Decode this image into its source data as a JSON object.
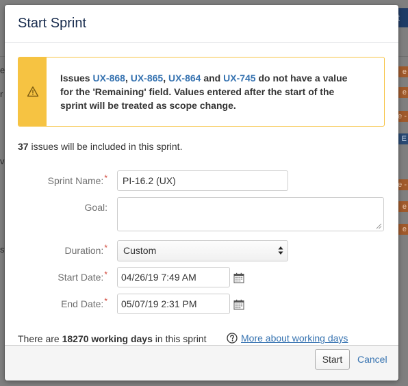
{
  "background": {
    "top_button": "rt",
    "side_texts": [
      "e",
      "r",
      "vo",
      "st"
    ],
    "badges": [
      "e F",
      "e F",
      "e -",
      "E",
      "e -",
      "e F",
      "e F"
    ]
  },
  "dialog": {
    "title": "Start Sprint",
    "warning": {
      "prefix": "Issues ",
      "issues": [
        "UX-868",
        "UX-865",
        "UX-864",
        "UX-745"
      ],
      "sep1": ", ",
      "sep2": ", ",
      "and": " and ",
      "suffix": " do not have a value for the 'Remaining' field. Values entered after the start of the sprint will be treated as scope change."
    },
    "issue_count": {
      "number": "37",
      "text": " issues will be included in this sprint."
    },
    "form": {
      "sprint_name_label": "Sprint Name:",
      "sprint_name_value": "PI-16.2 (UX)",
      "goal_label": "Goal:",
      "goal_value": "",
      "duration_label": "Duration:",
      "duration_value": "Custom",
      "start_date_label": "Start Date:",
      "start_date_value": "04/26/19 7:49 AM",
      "end_date_label": "End Date:",
      "end_date_value": "05/07/19 2:31 PM",
      "required_mark": "*"
    },
    "working_days": {
      "prefix": "There are ",
      "bold": "18270 working days",
      "suffix": " in this sprint",
      "help_link": "More about working days"
    },
    "footer": {
      "start_label": "Start",
      "cancel_label": "Cancel"
    }
  },
  "colors": {
    "link": "#3572b0",
    "warning": "#f6c342",
    "required": "#d04437"
  },
  "icons": [
    "warning-icon",
    "calendar-icon",
    "help-icon",
    "select-arrows-icon",
    "resize-grip-icon"
  ]
}
